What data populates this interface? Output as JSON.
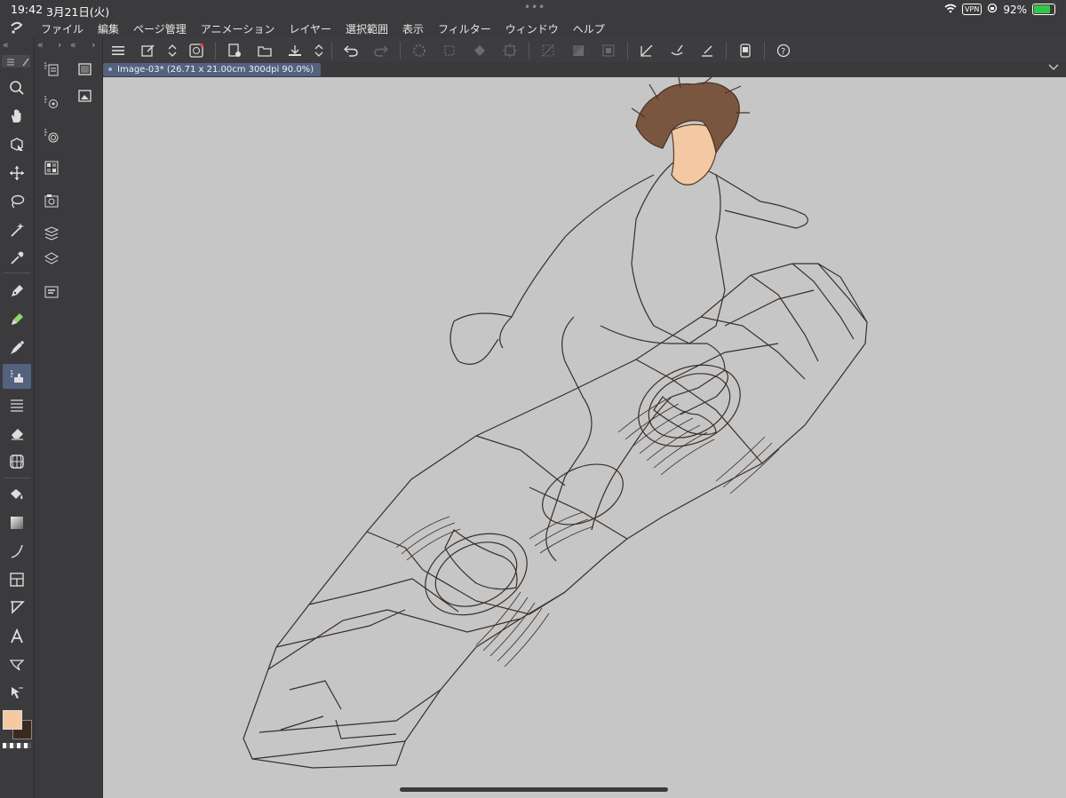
{
  "status": {
    "time": "19:42",
    "date": "3月21日(火)",
    "vpn": "VPN",
    "battery": "92%",
    "dots": "•••"
  },
  "menu": {
    "items": [
      "ファイル",
      "編集",
      "ページ管理",
      "アニメーション",
      "レイヤー",
      "選択範囲",
      "表示",
      "フィルター",
      "ウィンドウ",
      "ヘルプ"
    ]
  },
  "document": {
    "tab_label": "Image-03* (26.71 x 21.00cm 300dpi 90.0%)"
  },
  "colors": {
    "main": "#f6c9a1",
    "sub": "#3a2a1e",
    "accent": "#52627f",
    "canvas": "#c6c6c6"
  },
  "icons": {
    "tools": [
      "zoom-icon",
      "hand-icon",
      "object-icon",
      "move-icon",
      "lasso-icon",
      "magic-wand-icon",
      "eyedropper-icon",
      "pen-icon",
      "pencil-icon",
      "brush-icon",
      "airbrush-icon",
      "decoration-icon",
      "eraser-icon",
      "perspective-icon",
      "fill-icon",
      "gradient-icon",
      "curve-icon",
      "frame-icon",
      "ruler-icon",
      "text-icon",
      "balloon-icon",
      "correct-line-icon"
    ]
  }
}
